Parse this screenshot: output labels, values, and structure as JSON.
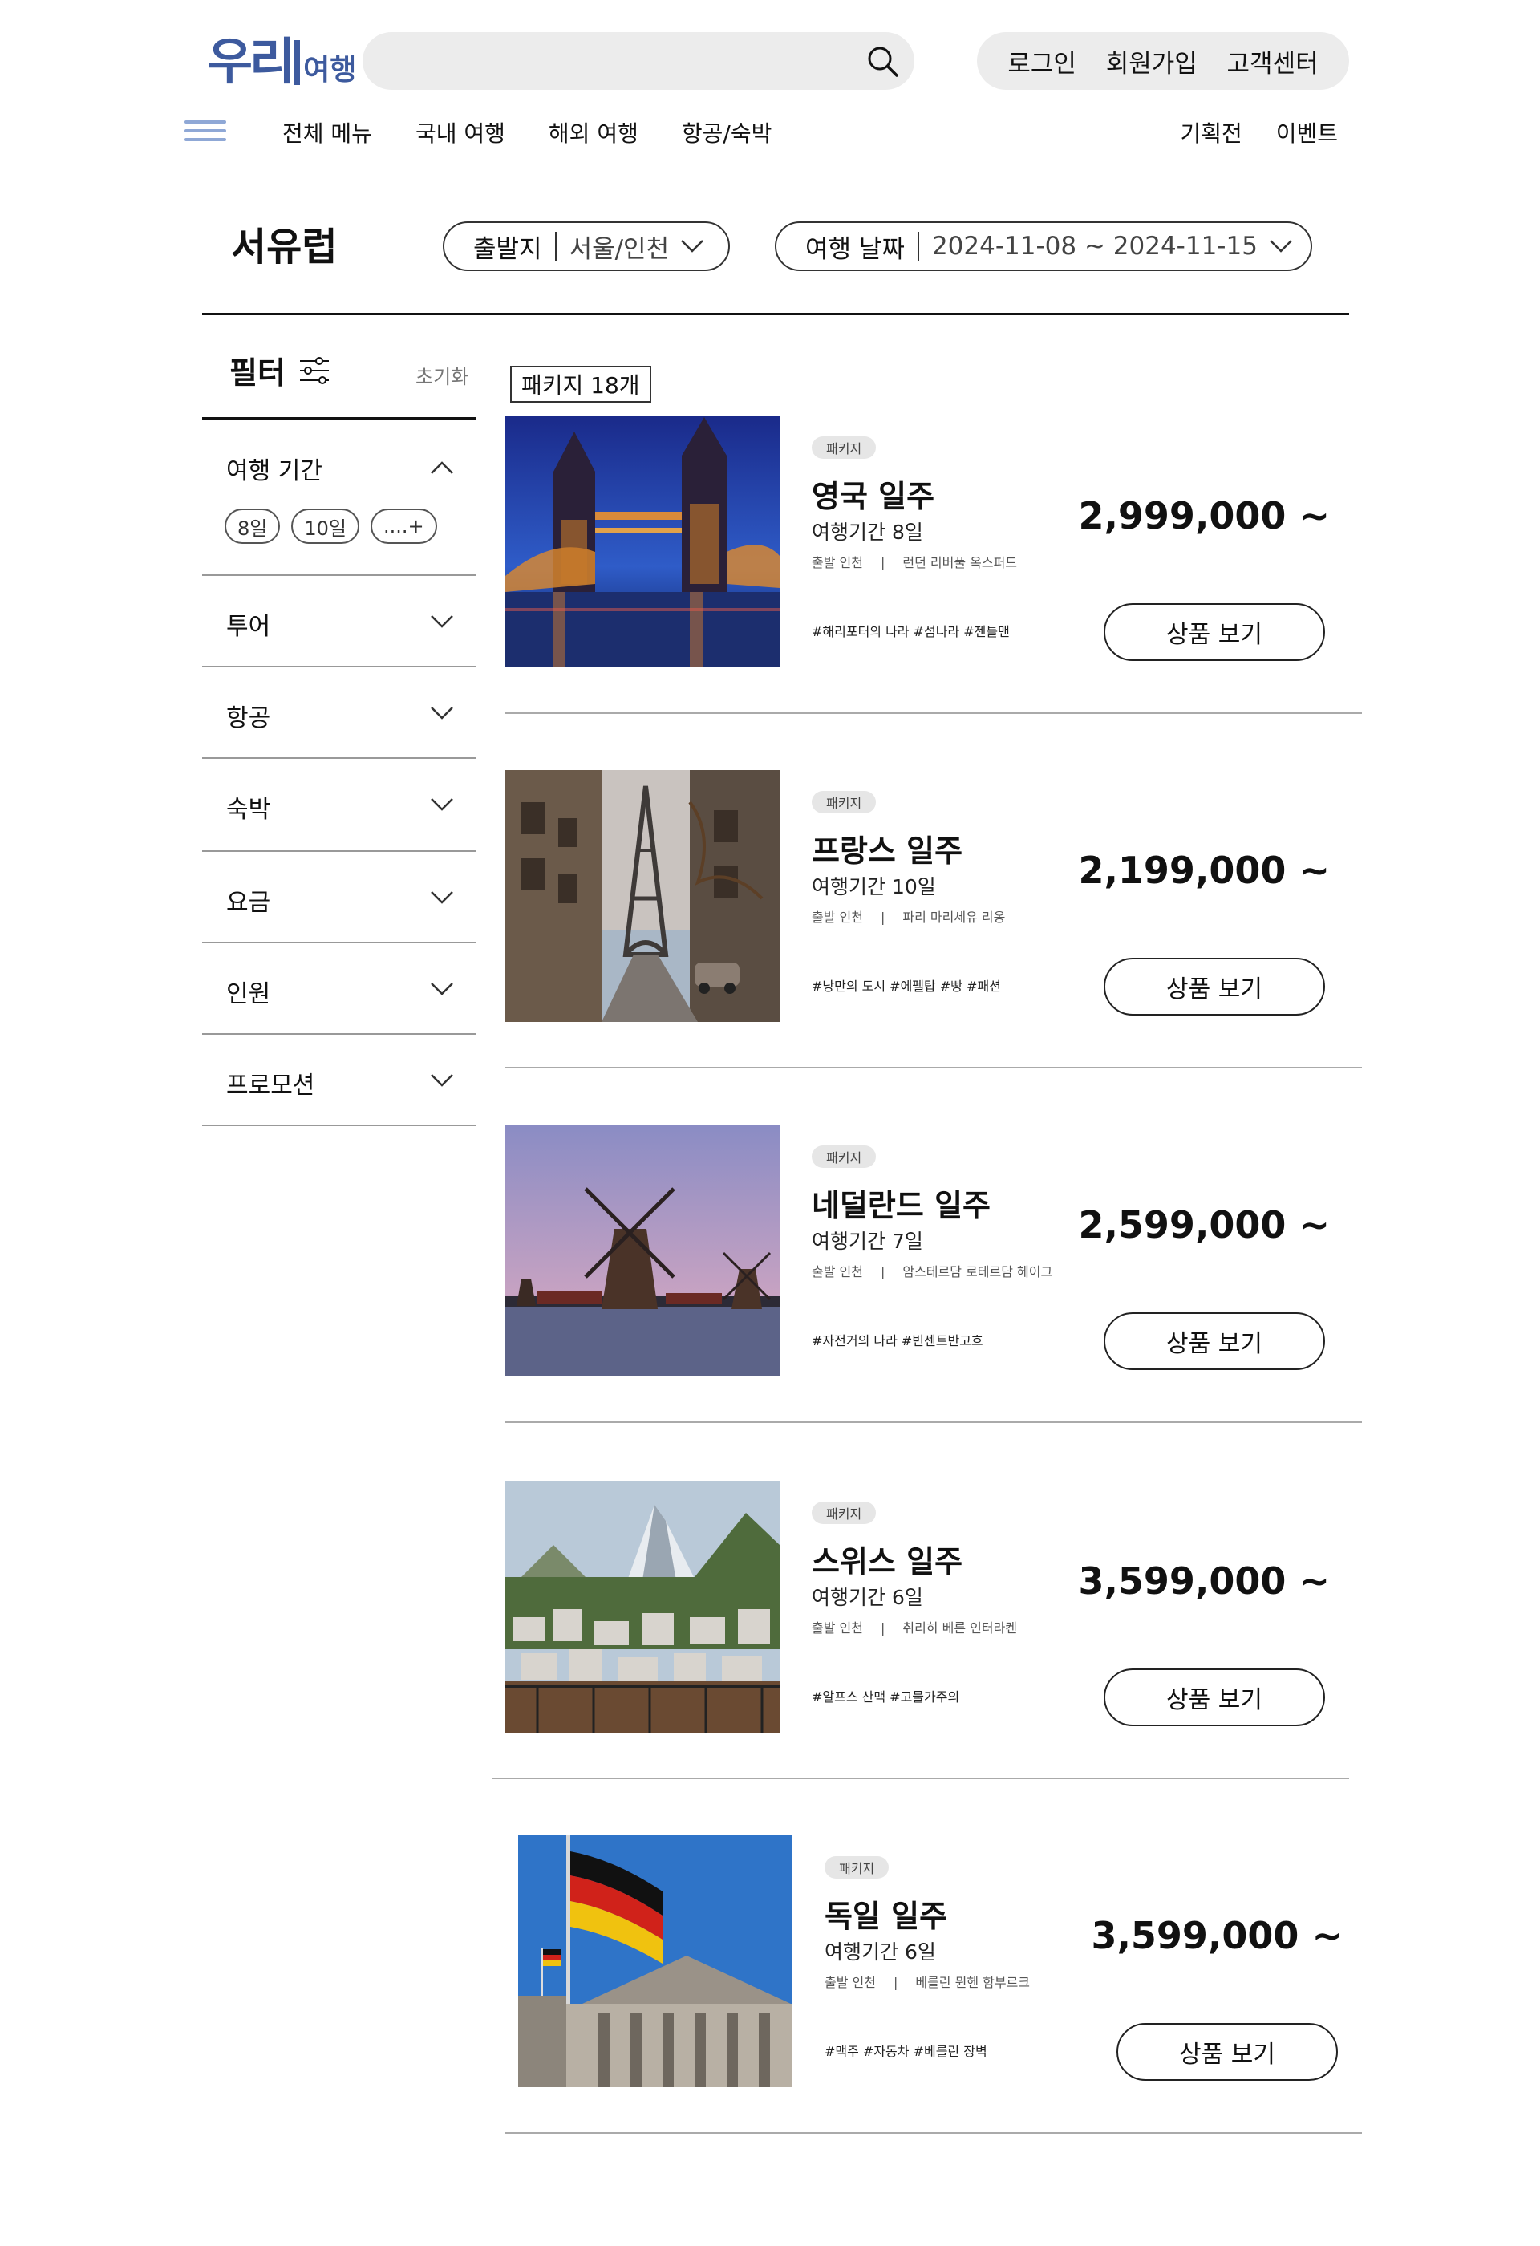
{
  "brand": {
    "mark": "우리",
    "text": "여행",
    "color": "#3d5a9e"
  },
  "search": {
    "placeholder": "",
    "value": ""
  },
  "user_menu": {
    "login": "로그인",
    "signup": "회원가입",
    "support": "고객센터"
  },
  "gnb": {
    "left": [
      "전체 메뉴",
      "국내 여행",
      "해외 여행",
      "항공/숙박"
    ],
    "right": [
      "기획전",
      "이벤트"
    ]
  },
  "page": {
    "title": "서유럽",
    "origin": {
      "label": "출발지",
      "value": "서울/인천"
    },
    "date": {
      "label": "여행 날짜",
      "value": "2024-11-08 ~ 2024-11-15"
    }
  },
  "filter": {
    "title": "필터",
    "reset": "초기화",
    "sections": [
      {
        "name": "여행 기간",
        "expanded": true,
        "chips": [
          "8일",
          "10일",
          "....+"
        ]
      },
      {
        "name": "투어",
        "expanded": false
      },
      {
        "name": "항공",
        "expanded": false
      },
      {
        "name": "숙박",
        "expanded": false
      },
      {
        "name": "요금",
        "expanded": false
      },
      {
        "name": "인원",
        "expanded": false
      },
      {
        "name": "프로모션",
        "expanded": false
      }
    ]
  },
  "results": {
    "count_label": "패키지 18개",
    "items": [
      {
        "badge": "패키지",
        "name": "영국 일주",
        "period": "여행기간 8일",
        "origin": "출발 인천",
        "cities": "런던  리버풀  옥스퍼드",
        "tags": "#해리포터의 나라 #섬나라 #젠틀맨",
        "price": "2,999,000 ~",
        "button": "상품 보기",
        "image_icon": "tower-bridge-photo"
      },
      {
        "badge": "패키지",
        "name": "프랑스 일주",
        "period": "여행기간 10일",
        "origin": "출발 인천",
        "cities": "파리  마리세유  리옹",
        "tags": "#낭만의 도시 #에펠탑 #빵 #패션",
        "price": "2,199,000 ~",
        "button": "상품 보기",
        "image_icon": "eiffel-tower-photo"
      },
      {
        "badge": "패키지",
        "name": "네덜란드 일주",
        "period": "여행기간 7일",
        "origin": "출발 인천",
        "cities": "암스테르담  로테르담  헤이그",
        "tags": "#자전거의 나라 #빈센트반고흐",
        "price": "2,599,000 ~",
        "button": "상품 보기",
        "image_icon": "windmill-photo"
      },
      {
        "badge": "패키지",
        "name": "스위스 일주",
        "period": "여행기간 6일",
        "origin": "출발 인천",
        "cities": "취리히  베른  인터라켄",
        "tags": "#알프스 산맥 #고물가주의",
        "price": "3,599,000 ~",
        "button": "상품 보기",
        "image_icon": "matterhorn-photo"
      },
      {
        "badge": "패키지",
        "name": "독일 일주",
        "period": "여행기간 6일",
        "origin": "출발 인천",
        "cities": "베를린  뮌헨  함부르크",
        "tags": "#맥주 #자동차 #베를린 장벽",
        "price": "3,599,000 ~",
        "button": "상품 보기",
        "image_icon": "german-flag-photo"
      }
    ]
  }
}
